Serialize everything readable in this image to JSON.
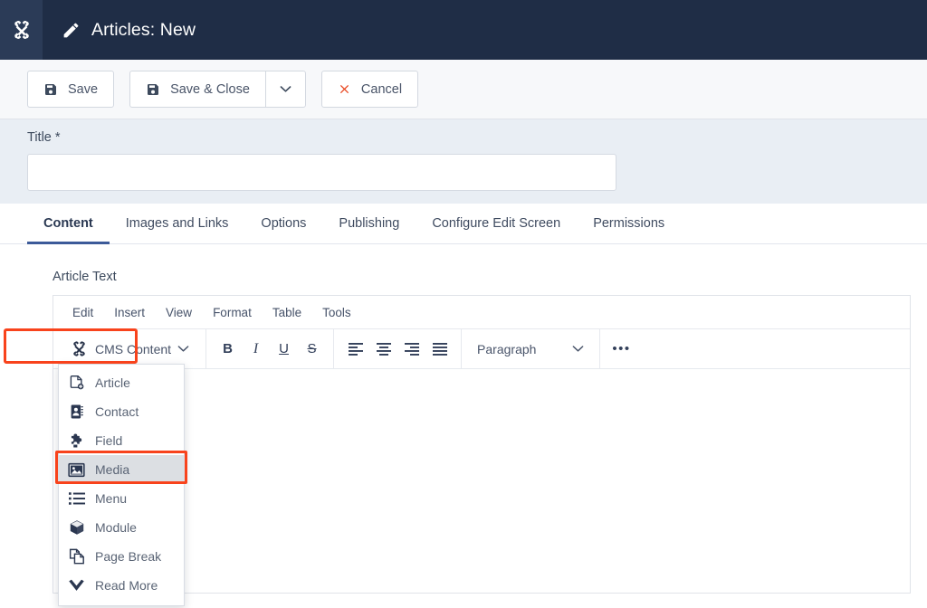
{
  "header": {
    "brand_icon": "joomla-logo-icon",
    "title_icon": "pencil-icon",
    "title": "Articles: New"
  },
  "actionbar": {
    "save": {
      "label": "Save",
      "icon": "floppy-disk-icon"
    },
    "save_close": {
      "label": "Save & Close",
      "icon": "floppy-disk-icon"
    },
    "save_dropdown_icon": "chevron-down-icon",
    "cancel": {
      "label": "Cancel",
      "icon": "close-x-icon"
    }
  },
  "title_field": {
    "label": "Title *",
    "value": "",
    "placeholder": ""
  },
  "tabs": [
    {
      "label": "Content",
      "active": true
    },
    {
      "label": "Images and Links",
      "active": false
    },
    {
      "label": "Options",
      "active": false
    },
    {
      "label": "Publishing",
      "active": false
    },
    {
      "label": "Configure Edit Screen",
      "active": false
    },
    {
      "label": "Permissions",
      "active": false
    }
  ],
  "editor": {
    "label": "Article Text",
    "menubar": [
      "Edit",
      "Insert",
      "View",
      "Format",
      "Table",
      "Tools"
    ],
    "cms_button": {
      "label": "CMS Content",
      "icon": "joomla-logo-icon",
      "caret_icon": "chevron-down-icon",
      "highlighted": true,
      "highlight_color": "#f8431c"
    },
    "format_buttons": [
      {
        "name": "bold",
        "glyph": "B"
      },
      {
        "name": "italic",
        "glyph": "I"
      },
      {
        "name": "underline",
        "glyph": "U"
      },
      {
        "name": "strikethrough",
        "glyph": "S"
      }
    ],
    "align_buttons": [
      {
        "name": "align-left"
      },
      {
        "name": "align-center"
      },
      {
        "name": "align-right"
      },
      {
        "name": "align-justify"
      }
    ],
    "paragraph_select": {
      "value": "Paragraph",
      "caret_icon": "chevron-down-icon"
    },
    "overflow_button": {
      "label": "•••",
      "name": "more-options"
    },
    "content": ""
  },
  "cms_menu": {
    "selected": "Media",
    "highlight_color": "#f8431c",
    "items": [
      {
        "label": "Article",
        "icon": "article-add-icon"
      },
      {
        "label": "Contact",
        "icon": "contact-card-icon"
      },
      {
        "label": "Field",
        "icon": "puzzle-piece-icon"
      },
      {
        "label": "Media",
        "icon": "image-icon"
      },
      {
        "label": "Menu",
        "icon": "list-icon"
      },
      {
        "label": "Module",
        "icon": "cube-icon"
      },
      {
        "label": "Page Break",
        "icon": "pages-icon"
      },
      {
        "label": "Read More",
        "icon": "chevron-down-bold-icon"
      }
    ]
  },
  "colors": {
    "header_bg": "#1f2d46",
    "brand_bg": "#2b3b57",
    "accent_tab": "#3c5a99",
    "highlight_red": "#f8431c",
    "cancel_red": "#e8421a",
    "panel_bg": "#e9eef4"
  }
}
